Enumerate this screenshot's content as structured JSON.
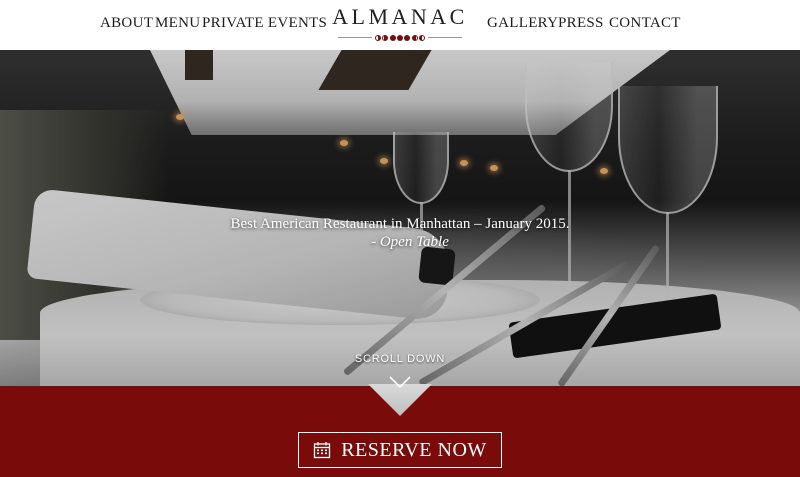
{
  "nav": {
    "left": [
      "ABOUT",
      "MENU",
      "PRIVATE EVENTS"
    ],
    "right": [
      "GALLERY",
      "PRESS",
      "CONTACT"
    ],
    "logo": "ALMANAC"
  },
  "hero": {
    "quote": "Best American Restaurant in Manhattan – January 2015.",
    "source": "- Open Table",
    "scroll_label": "SCROLL DOWN"
  },
  "cta": {
    "label": "RESERVE NOW",
    "icon": "calendar-icon"
  },
  "colors": {
    "accent": "#7a0b0b",
    "nav_text": "#1c1c1c"
  }
}
